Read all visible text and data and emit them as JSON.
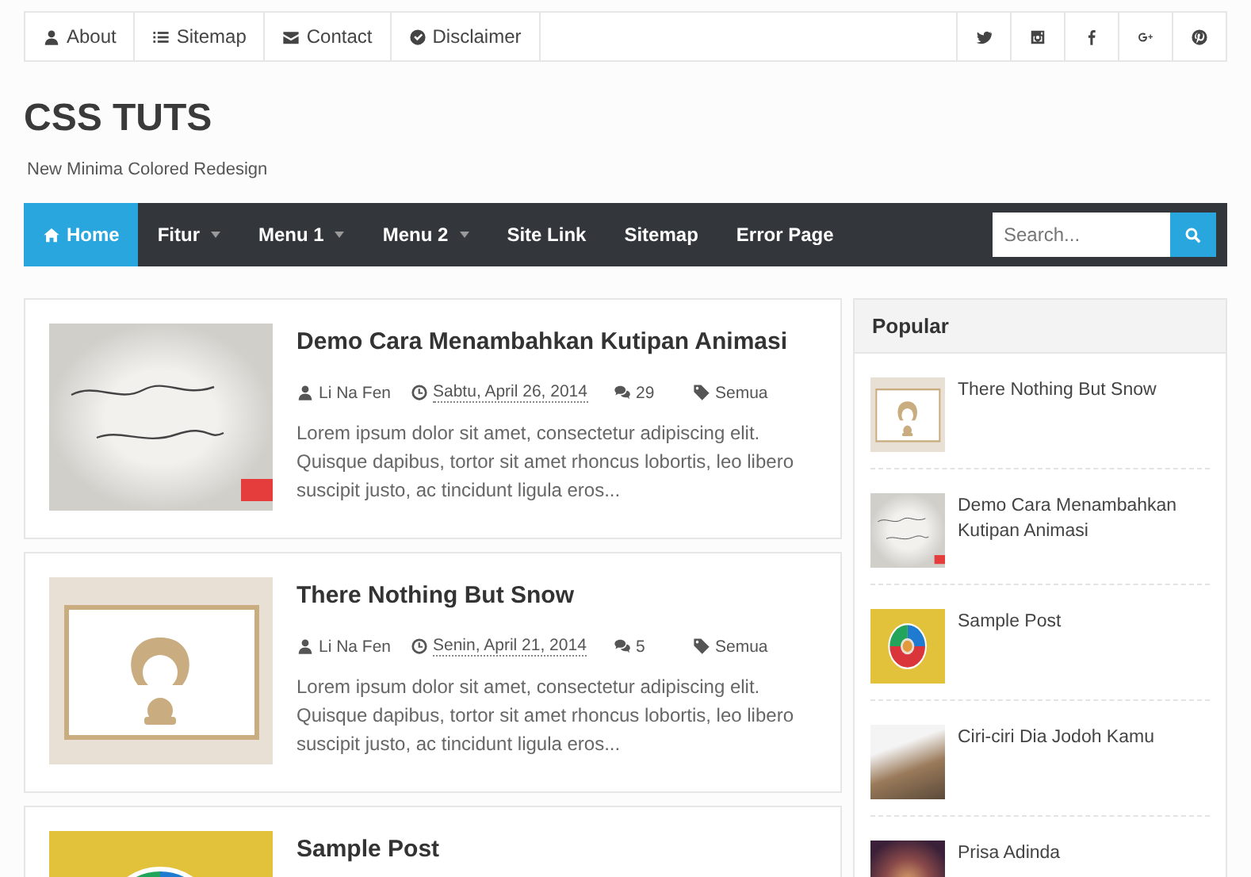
{
  "top_links": [
    {
      "label": "About",
      "kind": "user"
    },
    {
      "label": "Sitemap",
      "kind": "list"
    },
    {
      "label": "Contact",
      "kind": "envelope"
    },
    {
      "label": "Disclaimer",
      "kind": "check"
    }
  ],
  "social": [
    {
      "kind": "twitter"
    },
    {
      "kind": "instagram"
    },
    {
      "kind": "facebook"
    },
    {
      "kind": "googleplus"
    },
    {
      "kind": "pinterest"
    }
  ],
  "site": {
    "title": "CSS TUTS",
    "tagline": "New Minima Colored Redesign"
  },
  "nav": [
    {
      "label": "Home",
      "selected": true,
      "dropdown": false
    },
    {
      "label": "Fitur",
      "selected": false,
      "dropdown": true
    },
    {
      "label": "Menu 1",
      "selected": false,
      "dropdown": true
    },
    {
      "label": "Menu 2",
      "selected": false,
      "dropdown": true
    },
    {
      "label": "Site Link",
      "selected": false,
      "dropdown": false
    },
    {
      "label": "Sitemap",
      "selected": false,
      "dropdown": false
    },
    {
      "label": "Error Page",
      "selected": false,
      "dropdown": false
    }
  ],
  "search": {
    "placeholder": "Search..."
  },
  "posts": [
    {
      "title": "Demo Cara Menambahkan Kutipan Animasi",
      "kind": "quote",
      "author": "Li Na Fen",
      "date": "Sabtu, April 26, 2014",
      "comments": "29",
      "label": "Semua",
      "excerpt": "Lorem ipsum dolor sit amet, consectetur adipiscing elit. Quisque dapibus, tortor sit amet rhoncus lobortis, leo libero suscipit justo, ac tincidunt ligula eros..."
    },
    {
      "title": "There Nothing But Snow",
      "kind": "cartoon",
      "author": "Li Na Fen",
      "date": "Senin, April 21, 2014",
      "comments": "5",
      "label": "Semua",
      "excerpt": "Lorem ipsum dolor sit amet, consectetur adipiscing elit. Quisque dapibus, tortor sit amet rhoncus lobortis, leo libero suscipit justo, ac tincidunt ligula eros..."
    },
    {
      "title": "Sample Post",
      "kind": "wheel"
    }
  ],
  "popular": {
    "title": "Popular",
    "items": [
      {
        "title": "There Nothing But Snow",
        "kind": "cartoon"
      },
      {
        "title": "Demo Cara Menambahkan Kutipan Animasi",
        "kind": "quote"
      },
      {
        "title": "Sample Post",
        "kind": "wheel"
      },
      {
        "title": "Ciri-ciri Dia Jodoh Kamu",
        "kind": "photo"
      },
      {
        "title": "Prisa Adinda",
        "kind": "photo2"
      }
    ]
  }
}
